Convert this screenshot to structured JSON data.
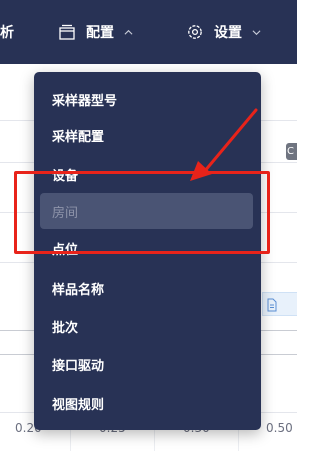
{
  "nav": {
    "previous_fragment": "析",
    "config_label": "配置",
    "settings_label": "设置"
  },
  "dropdown": {
    "items": [
      {
        "label": "采样器型号"
      },
      {
        "label": "采样配置"
      },
      {
        "label": "设备"
      },
      {
        "label": "房间",
        "state": "hover"
      },
      {
        "label": "点位"
      },
      {
        "label": "样品名称"
      },
      {
        "label": "批次"
      },
      {
        "label": "接口驱动"
      },
      {
        "label": "视图规则"
      }
    ]
  },
  "background": {
    "axis_ticks": [
      "0.20",
      "0.25",
      "0.30",
      "0.50"
    ]
  },
  "colors": {
    "nav_bg": "#283255",
    "menu_bg": "#283255",
    "menu_active_bg": "#4a5474",
    "annotation_red": "#e8231a"
  }
}
